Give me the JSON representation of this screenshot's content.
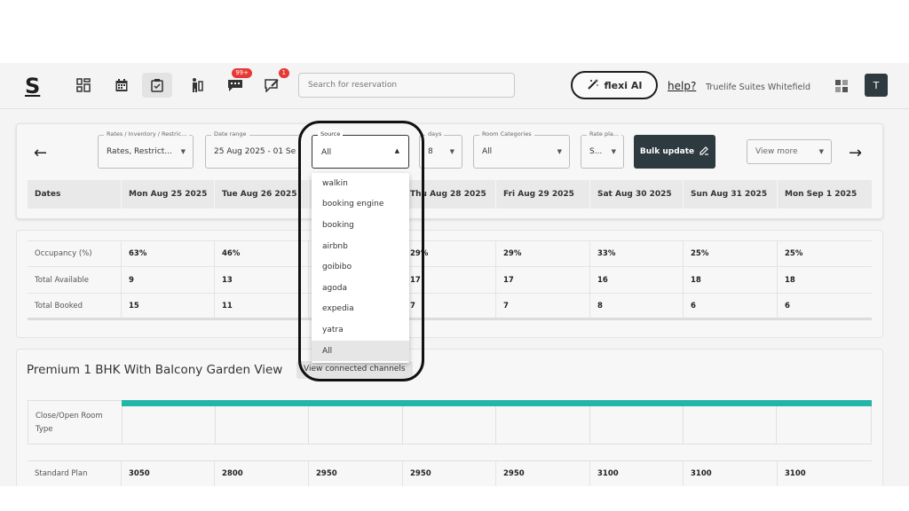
{
  "nav": {
    "logo": "S",
    "messages_badge": "99+",
    "notifications_badge": "1",
    "search_placeholder": "Search for reservation",
    "flexi_label": "flexi AI",
    "help_label": "help?",
    "property_name": "Truelife Suites Whitefield",
    "avatar_initial": "T"
  },
  "filters": {
    "rates_label": "Rates / Inventory / Restric...",
    "rates_value": "Rates, Restrict...",
    "date_label": "Date range",
    "date_value": "25 Aug 2025 - 01 Se",
    "source_label": "Source",
    "source_value": "All",
    "days_label": "days",
    "days_value": "8",
    "room_label": "Room Categories",
    "room_value": "All",
    "rateplan_label": "Rate pla...",
    "rateplan_value": "S...",
    "bulk_label": "Bulk update",
    "viewmore_label": "View more"
  },
  "source_options": [
    "walkin",
    "booking engine",
    "booking",
    "airbnb",
    "goibibo",
    "agoda",
    "expedia",
    "yatra",
    "All"
  ],
  "dates_header": {
    "label": "Dates",
    "days": [
      "Mon Aug 25 2025",
      "Tue Aug 26 2025",
      "",
      "Thu Aug 28 2025",
      "Fri Aug 29 2025",
      "Sat Aug 30 2025",
      "Sun Aug 31 2025",
      "Mon Sep 1 2025"
    ]
  },
  "stats": {
    "occupancy": {
      "label": "Occupancy (%)",
      "values": [
        "63%",
        "46%",
        "",
        "29%",
        "29%",
        "33%",
        "25%",
        "25%"
      ]
    },
    "available": {
      "label": "Total Available",
      "values": [
        "9",
        "13",
        "",
        "17",
        "17",
        "16",
        "18",
        "18"
      ]
    },
    "booked": {
      "label": "Total Booked",
      "values": [
        "15",
        "11",
        "",
        "7",
        "7",
        "8",
        "6",
        "6"
      ]
    }
  },
  "room": {
    "title": "Premium 1 BHK With Balcony Garden View",
    "connected_label": "View connected channels",
    "close_open_label": "Close/Open Room Type",
    "plan_label": "Standard Plan",
    "plan_values": [
      "3050",
      "2800",
      "2950",
      "2950",
      "2950",
      "3100",
      "3100",
      "3100"
    ]
  },
  "colors": {
    "teal": "#22b5a8",
    "dark": "#2d3a40",
    "badge": "#e53935"
  }
}
